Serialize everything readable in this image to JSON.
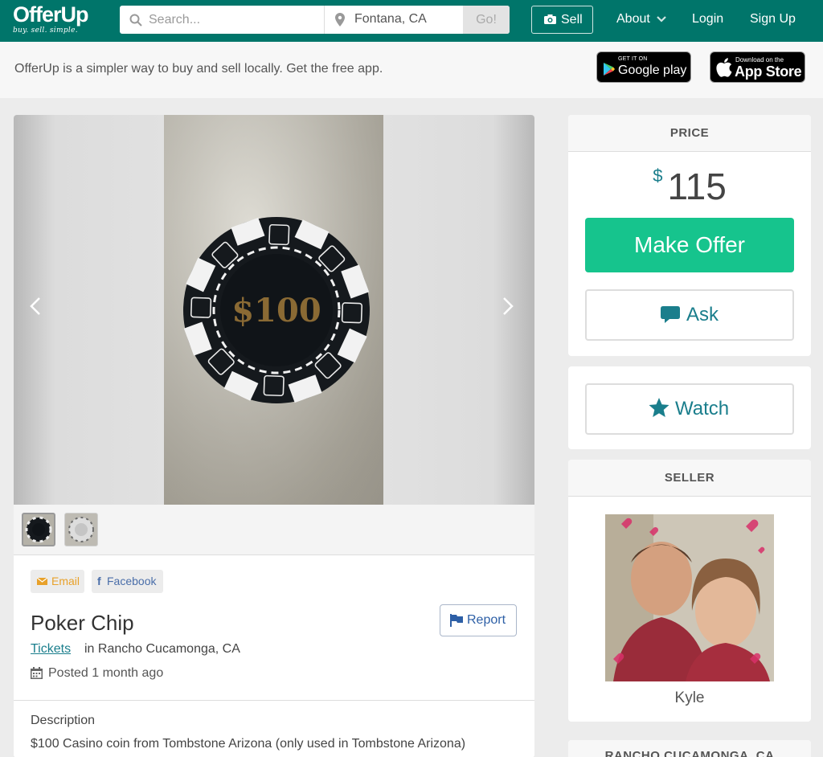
{
  "header": {
    "logo": "OfferUp",
    "tagline": "buy. sell. simple.",
    "search_placeholder": "Search...",
    "location": "Fontana, CA",
    "go_label": "Go!",
    "sell_label": "Sell",
    "nav": {
      "about": "About",
      "login": "Login",
      "signup": "Sign Up"
    }
  },
  "banner": {
    "message": "OfferUp is a simpler way to buy and sell locally. Get the free app.",
    "google_small": "GET IT ON",
    "google_big": "Google play",
    "apple_small": "Download on the",
    "apple_big": "App Store"
  },
  "listing": {
    "share_email": "Email",
    "share_facebook": "Facebook",
    "title": "Poker Chip",
    "report_label": "Report",
    "category": "Tickets",
    "location": "in Rancho Cucamonga, CA",
    "posted": "Posted 1 month ago",
    "description_heading": "Description",
    "description": "$100 Casino coin from Tombstone Arizona (only used in Tombstone Arizona)",
    "chip_text": "$100",
    "thumbnail_count": 2
  },
  "sidebar": {
    "price_heading": "PRICE",
    "currency": "$",
    "price": "115",
    "make_offer_label": "Make Offer",
    "ask_label": "Ask",
    "watch_label": "Watch",
    "seller_heading": "SELLER",
    "seller_name": "Kyle",
    "location_heading": "RANCHO CUCAMONGA, CA"
  },
  "colors": {
    "brand": "#00756a",
    "offer_button": "#16c48d",
    "accent_text": "#1a7e8c"
  },
  "icons": [
    "search-icon",
    "location-pin-icon",
    "camera-icon",
    "chevron-down-icon",
    "google-play-icon",
    "apple-icon",
    "chevron-left-icon",
    "chevron-right-icon",
    "envelope-icon",
    "flag-icon",
    "calendar-icon",
    "chat-bubble-icon",
    "star-icon"
  ]
}
